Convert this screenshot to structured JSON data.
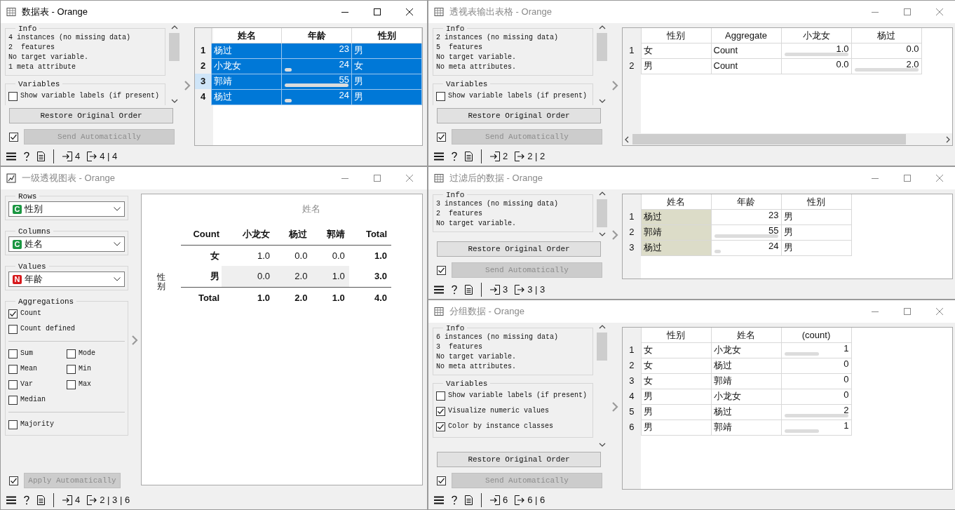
{
  "windows": [
    {
      "kind": "data_table",
      "title": "数据表 - Orange",
      "active": true,
      "info_title": "Info",
      "info": [
        "4 instances (no missing data)",
        "2  features",
        "No target variable.",
        "1 meta attribute"
      ],
      "variables_title": "Variables",
      "options": [
        {
          "label": "Show variable labels (if present)",
          "checked": false
        }
      ],
      "restore_button": "Restore Original Order",
      "auto": {
        "label": "Send Automatically",
        "checked": true,
        "disabled": true
      },
      "status": {
        "input": "4",
        "output": "4 | 4"
      },
      "table": {
        "columns": [
          {
            "label": "姓名",
            "kind": "text"
          },
          {
            "label": "年龄",
            "kind": "numeric"
          },
          {
            "label": "性别",
            "kind": "text"
          }
        ],
        "rows": [
          {
            "header": "1",
            "selected": true,
            "current": false,
            "cells": [
              {
                "text": "杨过"
              },
              {
                "text": "23"
              },
              {
                "text": "男"
              }
            ]
          },
          {
            "header": "2",
            "selected": true,
            "current": false,
            "cells": [
              {
                "text": "小龙女"
              },
              {
                "text": "24",
                "level": 0.03
              },
              {
                "text": "女"
              }
            ]
          },
          {
            "header": "3",
            "selected": true,
            "current": true,
            "cells": [
              {
                "text": "郭靖"
              },
              {
                "text": "55",
                "level": 1
              },
              {
                "text": "男"
              }
            ]
          },
          {
            "header": "4",
            "selected": true,
            "current": false,
            "cells": [
              {
                "text": "杨过"
              },
              {
                "text": "24",
                "level": 0.03
              },
              {
                "text": "男"
              }
            ]
          }
        ]
      }
    },
    {
      "kind": "data_table",
      "title": "透视表输出表格 - Orange",
      "active": false,
      "info_title": "Info",
      "info": [
        "2 instances (no missing data)",
        "5  features",
        "No target variable.",
        "No meta attributes."
      ],
      "variables_title": "Variables",
      "options": [
        {
          "label": "Show variable labels (if present)",
          "checked": false
        }
      ],
      "restore_button": "Restore Original Order",
      "auto": {
        "label": "Send Automatically",
        "checked": true,
        "disabled": true
      },
      "status": {
        "input": "2",
        "output": "2 | 2"
      },
      "table": {
        "h_scroll": true,
        "columns": [
          {
            "label": "性别",
            "kind": "text"
          },
          {
            "label": "Aggregate",
            "kind": "text"
          },
          {
            "label": "小龙女",
            "kind": "numeric"
          },
          {
            "label": "杨过",
            "kind": "numeric"
          }
        ],
        "rows": [
          {
            "header": "1",
            "selected": false,
            "cells": [
              {
                "text": "女"
              },
              {
                "text": "Count"
              },
              {
                "text": "1.0",
                "level": 1
              },
              {
                "text": "0.0"
              }
            ]
          },
          {
            "header": "2",
            "selected": false,
            "cells": [
              {
                "text": "男"
              },
              {
                "text": "Count"
              },
              {
                "text": "0.0"
              },
              {
                "text": "2.0",
                "level": 1
              }
            ]
          }
        ]
      }
    },
    {
      "kind": "pivot",
      "title": "一级透视图表 - Orange",
      "active": false,
      "selectors": [
        {
          "title": "Rows",
          "badge": "C",
          "color": "#1a9641",
          "value": "性别"
        },
        {
          "title": "Columns",
          "badge": "C",
          "color": "#1a9641",
          "value": "姓名"
        },
        {
          "title": "Values",
          "badge": "N",
          "color": "#d7191c",
          "value": "年龄"
        }
      ],
      "aggregations_title": "Aggregations",
      "aggregations": [
        [
          {
            "label": "Count",
            "checked": true
          },
          {
            "label": "Count defined",
            "checked": false
          }
        ],
        [
          {
            "label": "Sum",
            "checked": false
          },
          {
            "label": "Mode",
            "checked": false
          },
          {
            "label": "Mean",
            "checked": false
          },
          {
            "label": "Min",
            "checked": false
          },
          {
            "label": "Var",
            "checked": false
          },
          {
            "label": "Max",
            "checked": false
          },
          {
            "label": "Median",
            "checked": false
          }
        ],
        [
          {
            "label": "Majority",
            "checked": false
          }
        ]
      ],
      "auto": {
        "label": "Apply Automatically",
        "checked": true,
        "disabled": true
      },
      "status": {
        "input": "4",
        "output": "2 | 3 | 6"
      },
      "pivot": {
        "column_title": "姓名",
        "row_title": "性别",
        "corner": "Count",
        "columns": [
          "小龙女",
          "杨过",
          "郭靖"
        ],
        "total_column": "Total",
        "rows": [
          {
            "label": "女",
            "values": [
              "1.0",
              "0.0",
              "0.0"
            ],
            "total": "1.0",
            "highlighted": false
          },
          {
            "label": "男",
            "values": [
              "0.0",
              "2.0",
              "1.0"
            ],
            "total": "3.0",
            "highlighted": true
          }
        ],
        "totals": {
          "label": "Total",
          "values": [
            "1.0",
            "2.0",
            "1.0"
          ],
          "total": "4.0"
        }
      }
    },
    {
      "kind": "data_table",
      "title": "过滤后的数据 - Orange",
      "active": false,
      "info_title": "Info",
      "info": [
        "3 instances (no missing data)",
        "2  features",
        "No target variable."
      ],
      "restore_button": "Restore Original Order",
      "auto": {
        "label": "Send Automatically",
        "checked": true,
        "disabled": true
      },
      "status": {
        "input": "3",
        "output": "3 | 3"
      },
      "table": {
        "columns": [
          {
            "label": "姓名",
            "kind": "class"
          },
          {
            "label": "年龄",
            "kind": "numeric"
          },
          {
            "label": "性别",
            "kind": "text"
          }
        ],
        "rows": [
          {
            "header": "1",
            "selected": false,
            "cells": [
              {
                "text": "杨过"
              },
              {
                "text": "23"
              },
              {
                "text": "男"
              }
            ]
          },
          {
            "header": "2",
            "selected": false,
            "cells": [
              {
                "text": "郭靖"
              },
              {
                "text": "55",
                "level": 1
              },
              {
                "text": "男"
              }
            ]
          },
          {
            "header": "3",
            "selected": false,
            "cells": [
              {
                "text": "杨过"
              },
              {
                "text": "24",
                "level": 0.03
              },
              {
                "text": "男"
              }
            ]
          }
        ]
      }
    },
    {
      "kind": "data_table",
      "title": "分组数据 - Orange",
      "active": false,
      "info_title": "Info",
      "info": [
        "6 instances (no missing data)",
        "3  features",
        "No target variable.",
        "No meta attributes."
      ],
      "variables_title": "Variables",
      "options": [
        {
          "label": "Show variable labels (if present)",
          "checked": false
        },
        {
          "label": "Visualize numeric values",
          "checked": true
        },
        {
          "label": "Color by instance classes",
          "checked": true
        }
      ],
      "restore_button": "Restore Original Order",
      "auto": {
        "label": "Send Automatically",
        "checked": true,
        "disabled": true
      },
      "status": {
        "input": "6",
        "output": "6 | 6"
      },
      "table": {
        "columns": [
          {
            "label": "性别",
            "kind": "text"
          },
          {
            "label": "姓名",
            "kind": "text"
          },
          {
            "label": "(count)",
            "kind": "numeric"
          }
        ],
        "rows": [
          {
            "header": "1",
            "selected": false,
            "cells": [
              {
                "text": "女"
              },
              {
                "text": "小龙女"
              },
              {
                "text": "1",
                "level": 0.5
              }
            ]
          },
          {
            "header": "2",
            "selected": false,
            "cells": [
              {
                "text": "女"
              },
              {
                "text": "杨过"
              },
              {
                "text": "0"
              }
            ]
          },
          {
            "header": "3",
            "selected": false,
            "cells": [
              {
                "text": "女"
              },
              {
                "text": "郭靖"
              },
              {
                "text": "0"
              }
            ]
          },
          {
            "header": "4",
            "selected": false,
            "cells": [
              {
                "text": "男"
              },
              {
                "text": "小龙女"
              },
              {
                "text": "0"
              }
            ]
          },
          {
            "header": "5",
            "selected": false,
            "cells": [
              {
                "text": "男"
              },
              {
                "text": "杨过"
              },
              {
                "text": "2",
                "level": 1
              }
            ]
          },
          {
            "header": "6",
            "selected": false,
            "cells": [
              {
                "text": "男"
              },
              {
                "text": "郭靖"
              },
              {
                "text": "1",
                "level": 0.5
              }
            ]
          }
        ]
      }
    }
  ]
}
